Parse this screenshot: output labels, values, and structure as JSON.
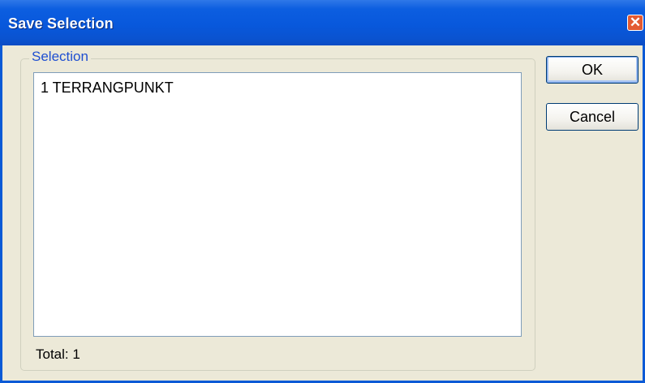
{
  "window": {
    "title": "Save Selection",
    "close_glyph": "✕"
  },
  "selection_group": {
    "legend": "Selection",
    "items": [
      "1 TERRANGPUNKT"
    ],
    "total_label": "Total: 1"
  },
  "buttons": {
    "ok_label": "OK",
    "cancel_label": "Cancel"
  },
  "icons": {
    "close": "close-icon"
  },
  "colors": {
    "titlebar": "#0858dc",
    "legend_text": "#1f4fd1",
    "close_button": "#e35a32",
    "dialog_background": "#ece9d8"
  }
}
